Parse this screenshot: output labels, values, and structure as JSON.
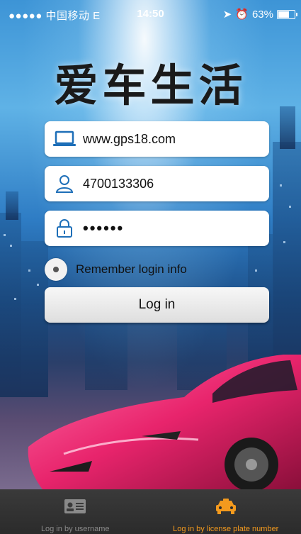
{
  "status_bar": {
    "carrier": "●●●●● 中国移动  E",
    "time": "14:50",
    "battery": "63%",
    "battery_level": 0.63
  },
  "logo": {
    "text": "爱车生活"
  },
  "login_form": {
    "server": {
      "value": "www.gps18.com",
      "icon": "laptop-icon"
    },
    "username": {
      "value": "4700133306",
      "icon": "user-icon"
    },
    "password": {
      "value": "••••••",
      "icon": "lock-icon"
    },
    "remember_label": "Remember login info",
    "remember_checked": false,
    "login_button": "Log in"
  },
  "tabs": [
    {
      "label": "Log in by username",
      "icon": "id-card-icon",
      "active": false
    },
    {
      "label": "Log in by license plate number",
      "icon": "car-icon",
      "active": true
    }
  ],
  "colors": {
    "accent": "#f39a1e",
    "tabbar": "#2f2f2f",
    "field_icon": "#1e6fb8"
  }
}
